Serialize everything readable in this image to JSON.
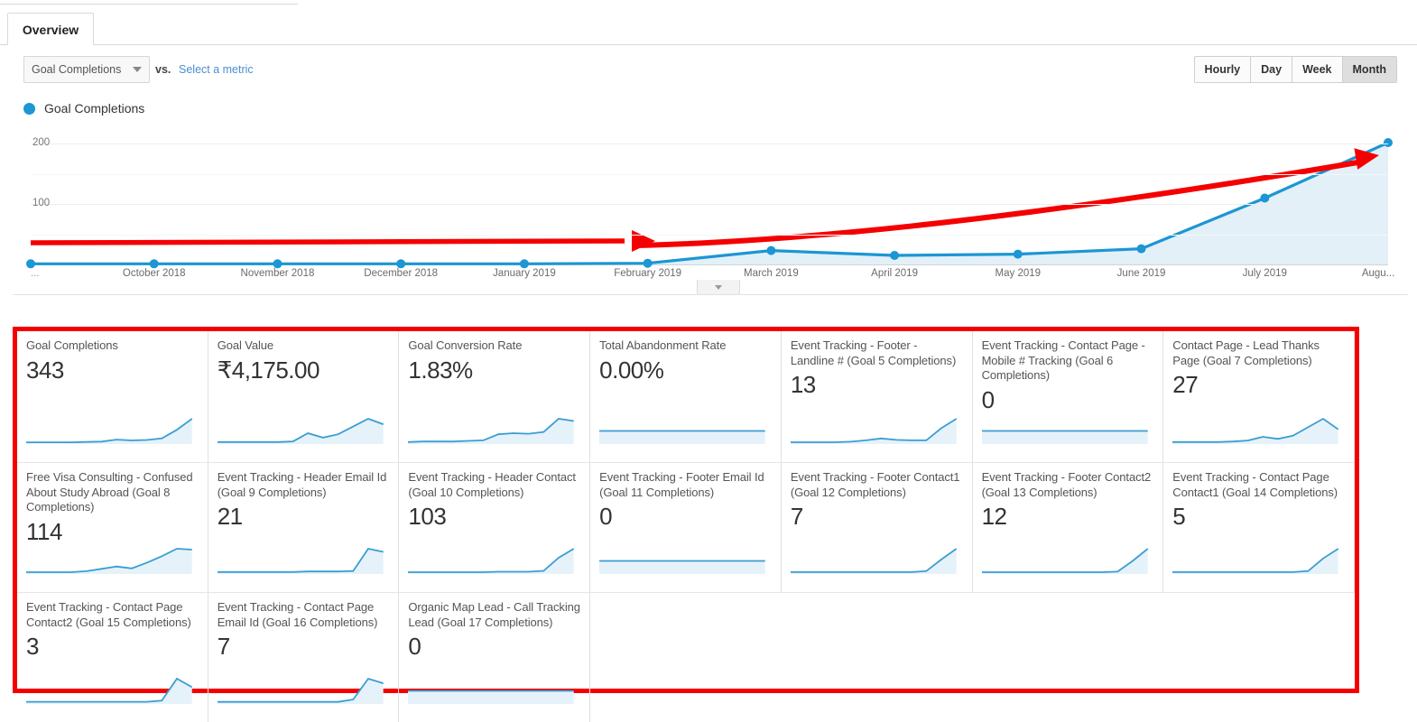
{
  "tabs": [
    {
      "label": "Overview",
      "active": true
    }
  ],
  "controls": {
    "metric_selector": {
      "value": "Goal Completions",
      "caret_icon": "chevron-down-icon"
    },
    "vs_label": "vs.",
    "compare_link": "Select a metric",
    "granularity": {
      "options": [
        "Hourly",
        "Day",
        "Week",
        "Month"
      ],
      "selected": "Month"
    }
  },
  "legend": {
    "series_name": "Goal Completions",
    "color": "#1c96d4"
  },
  "chart_data": {
    "type": "line",
    "title": "Goal Completions",
    "xlabel": "",
    "ylabel": "",
    "ylim": [
      0,
      220
    ],
    "yticks": [
      100,
      200
    ],
    "ytick_labels": [
      "100",
      "200"
    ],
    "grid": true,
    "legend_position": "top-left",
    "area_fill": true,
    "line_color": "#1c96d4",
    "fill_color": "#e3f0f8",
    "categories": [
      "...",
      "October 2018",
      "November 2018",
      "December 2018",
      "January 2019",
      "February 2019",
      "March 2019",
      "April 2019",
      "May 2019",
      "June 2019",
      "July 2019",
      "Augu..."
    ],
    "series": [
      {
        "name": "Goal Completions",
        "values": [
          1,
          1,
          1,
          1,
          1,
          2,
          23,
          15,
          17,
          26,
          110,
          202
        ]
      }
    ],
    "annotations": [
      {
        "type": "arrow",
        "color": "#f50000",
        "label": "flat-trend-arrow",
        "from": "...",
        "to": "February 2019"
      },
      {
        "type": "arrow",
        "color": "#f50000",
        "label": "growth-trend-arrow",
        "from": "February 2019",
        "to": "Augu..."
      }
    ]
  },
  "expander": {
    "icon": "chevron-down-icon"
  },
  "cards": [
    [
      {
        "title": "Goal Completions",
        "value": "343",
        "spark": [
          2,
          2,
          2,
          2,
          3,
          4,
          9,
          7,
          8,
          12,
          34,
          62
        ]
      },
      {
        "title": "Goal Value",
        "value": "₹4,175.00",
        "spark": [
          2,
          2,
          2,
          2,
          2,
          3,
          18,
          10,
          16,
          30,
          44,
          34
        ]
      },
      {
        "title": "Goal Conversion Rate",
        "value": "1.83%",
        "spark": [
          2,
          3,
          3,
          3,
          4,
          5,
          16,
          18,
          17,
          20,
          44,
          40
        ]
      },
      {
        "title": "Total Abandonment Rate",
        "value": "0.00%",
        "spark": [
          2,
          2,
          2,
          2,
          2,
          2,
          2,
          2,
          2,
          2,
          2,
          2
        ]
      },
      {
        "title": "Event Tracking - Footer - Landline # (Goal 5 Completions)",
        "value": "13",
        "spark": [
          2,
          2,
          2,
          2,
          3,
          6,
          10,
          7,
          6,
          6,
          32,
          52
        ]
      },
      {
        "title": "Event Tracking - Contact Page - Mobile # Tracking (Goal 6 Completions)",
        "value": "0",
        "spark": [
          2,
          2,
          2,
          2,
          2,
          2,
          2,
          2,
          2,
          2,
          2,
          2
        ]
      },
      {
        "title": "Contact Page - Lead Thanks Page (Goal 7 Completions)",
        "value": "27",
        "spark": [
          2,
          2,
          2,
          2,
          3,
          5,
          12,
          8,
          14,
          30,
          46,
          26
        ]
      }
    ],
    [
      {
        "title": "Free Visa Consulting - Confused About Study Abroad (Goal 8 Completions)",
        "value": "114",
        "spark": [
          2,
          2,
          2,
          2,
          4,
          9,
          14,
          10,
          22,
          36,
          52,
          50
        ]
      },
      {
        "title": "Event Tracking - Header Email Id (Goal 9 Completions)",
        "value": "21",
        "spark": [
          2,
          2,
          2,
          2,
          2,
          2,
          3,
          3,
          3,
          4,
          46,
          40
        ]
      },
      {
        "title": "Event Tracking - Header Contact (Goal 10 Completions)",
        "value": "103",
        "spark": [
          2,
          2,
          2,
          2,
          2,
          2,
          3,
          3,
          3,
          5,
          34,
          54
        ]
      },
      {
        "title": "Event Tracking - Footer Email Id (Goal 11 Completions)",
        "value": "0",
        "spark": [
          2,
          2,
          2,
          2,
          2,
          2,
          2,
          2,
          2,
          2,
          2,
          2
        ]
      },
      {
        "title": "Event Tracking - Footer Contact1 (Goal 12 Completions)",
        "value": "7",
        "spark": [
          2,
          2,
          2,
          2,
          2,
          2,
          2,
          2,
          2,
          4,
          28,
          50
        ]
      },
      {
        "title": "Event Tracking - Footer Contact2 (Goal 13 Completions)",
        "value": "12",
        "spark": [
          2,
          2,
          2,
          2,
          2,
          2,
          2,
          2,
          2,
          3,
          26,
          52
        ]
      },
      {
        "title": "Event Tracking - Contact Page Contact1 (Goal 14 Completions)",
        "value": "5",
        "spark": [
          2,
          2,
          2,
          2,
          2,
          2,
          2,
          2,
          2,
          4,
          30,
          50
        ]
      }
    ],
    [
      {
        "title": "Event Tracking - Contact Page Contact2 (Goal 15 Completions)",
        "value": "3",
        "spark": [
          2,
          2,
          2,
          2,
          2,
          2,
          2,
          2,
          2,
          4,
          40,
          26
        ]
      },
      {
        "title": "Event Tracking - Contact Page Email Id (Goal 16 Completions)",
        "value": "7",
        "spark": [
          2,
          2,
          2,
          2,
          2,
          2,
          2,
          2,
          2,
          6,
          42,
          34
        ]
      },
      {
        "title": "Organic Map Lead - Call Tracking Lead (Goal 17 Completions)",
        "value": "0",
        "spark": [
          2,
          2,
          2,
          2,
          2,
          2,
          2,
          2,
          2,
          2,
          2,
          2
        ]
      }
    ]
  ]
}
